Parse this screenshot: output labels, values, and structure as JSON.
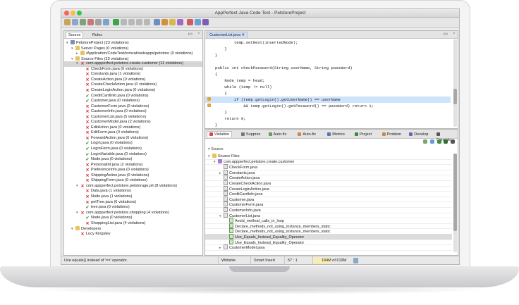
{
  "window": {
    "title": "AppPerfect Java Code Test - PetstoreProject"
  },
  "left_panel": {
    "tabs": [
      "Source",
      "Rules"
    ],
    "tree": [
      {
        "depth": 0,
        "twisty": "▾",
        "icon": "project",
        "label": "PetstoreProject (23 violations)"
      },
      {
        "depth": 1,
        "twisty": "▾",
        "icon": "folder",
        "label": "Server Pages (0 violations)"
      },
      {
        "depth": 2,
        "twisty": "▸",
        "icon": "folder",
        "label": "/Application/CodeTest/tomcat/webapps/petstore (0 violations)"
      },
      {
        "depth": 1,
        "twisty": "▾",
        "icon": "folder",
        "label": "Source Files (23 violations)"
      },
      {
        "depth": 2,
        "twisty": "▾",
        "icon": "x",
        "label": "com.appperfect.petstore.create.customer (11 violations)",
        "selected": true
      },
      {
        "depth": 3,
        "twisty": "",
        "icon": "x",
        "label": "CheckForm.java (0 violations)"
      },
      {
        "depth": 3,
        "twisty": "",
        "icon": "x",
        "label": "Constants.java (1 violations)"
      },
      {
        "depth": 3,
        "twisty": "",
        "icon": "x",
        "label": "CreateAction.java (0 violations)"
      },
      {
        "depth": 3,
        "twisty": "",
        "icon": "x",
        "label": "CreateCheckAction.java (0 violations)"
      },
      {
        "depth": 3,
        "twisty": "",
        "icon": "x",
        "label": "CreateLoginAction.java (0 violations)"
      },
      {
        "depth": 3,
        "twisty": "",
        "icon": "ok",
        "label": "CreditCardInfo.java (0 violations)"
      },
      {
        "depth": 3,
        "twisty": "",
        "icon": "ok",
        "label": "Customer.java (0 violations)"
      },
      {
        "depth": 3,
        "twisty": "",
        "icon": "x",
        "label": "CustomerForm.java (0 violations)"
      },
      {
        "depth": 3,
        "twisty": "",
        "icon": "x",
        "label": "CustomerInfo.java (0 violations)"
      },
      {
        "depth": 3,
        "twisty": "",
        "icon": "x",
        "label": "CustomerList.java (5 violations)"
      },
      {
        "depth": 3,
        "twisty": "",
        "icon": "x",
        "label": "CustomerModel.java (2 violations)"
      },
      {
        "depth": 3,
        "twisty": "",
        "icon": "x",
        "label": "EditAction.java (0 violations)"
      },
      {
        "depth": 3,
        "twisty": "",
        "icon": "x",
        "label": "EditForm.java (0 violations)"
      },
      {
        "depth": 3,
        "twisty": "",
        "icon": "x",
        "label": "ForwardAction.java (0 violations)"
      },
      {
        "depth": 3,
        "twisty": "",
        "icon": "ok",
        "label": "Login.java (0 violations)"
      },
      {
        "depth": 3,
        "twisty": "",
        "icon": "ok",
        "label": "LoginForm.java (0 violations)"
      },
      {
        "depth": 3,
        "twisty": "",
        "icon": "ok",
        "label": "LoginVariable.java (0 violations)"
      },
      {
        "depth": 3,
        "twisty": "",
        "icon": "ok",
        "label": "Node.java (0 violations)"
      },
      {
        "depth": 3,
        "twisty": "",
        "icon": "x",
        "label": "PersonalInf.java (2 violations)"
      },
      {
        "depth": 3,
        "twisty": "",
        "icon": "x",
        "label": "PreferenceInfo.java (0 violations)"
      },
      {
        "depth": 3,
        "twisty": "",
        "icon": "x",
        "label": "ShippingAction.java (0 violations)"
      },
      {
        "depth": 3,
        "twisty": "",
        "icon": "x",
        "label": "ShippingForm.java (0 violations)"
      },
      {
        "depth": 2,
        "twisty": "▾",
        "icon": "x",
        "label": "com.appperfect.petstore.petstorage.pit (8 violations)"
      },
      {
        "depth": 3,
        "twisty": "",
        "icon": "x",
        "label": "Data.java (1 violations)"
      },
      {
        "depth": 3,
        "twisty": "",
        "icon": "x",
        "label": "Node.java (1 violations)"
      },
      {
        "depth": 3,
        "twisty": "",
        "icon": "x",
        "label": "petTree.java (6 violations)"
      },
      {
        "depth": 3,
        "twisty": "",
        "icon": "ok",
        "label": "tree.java (0 violations)"
      },
      {
        "depth": 2,
        "twisty": "▾",
        "icon": "x",
        "label": "com.appperfect.petstore.shopping (4 violations)"
      },
      {
        "depth": 3,
        "twisty": "",
        "icon": "ok",
        "label": "Node.java (0 violations)"
      },
      {
        "depth": 3,
        "twisty": "",
        "icon": "x",
        "label": "ShoppingList.java (4 violations)"
      },
      {
        "depth": 1,
        "twisty": "▾",
        "icon": "folder",
        "label": "Developers"
      },
      {
        "depth": 2,
        "twisty": "",
        "icon": "x",
        "label": "Lucy Kingsley"
      }
    ]
  },
  "editor": {
    "tab": "CustomerList.java",
    "lines": [
      {
        "text": "        temp.setNext(insertedNode);",
        "hl": false
      },
      {
        "text": "    }",
        "hl": false
      },
      {
        "text": "}",
        "hl": false
      },
      {
        "text": "",
        "hl": false
      },
      {
        "text": "public int checkPassword(String userName, String passWord)",
        "hl": false
      },
      {
        "text": "{",
        "hl": false
      },
      {
        "text": "    Node temp = head;",
        "hl": false
      },
      {
        "text": "    while (temp != null)",
        "hl": false
      },
      {
        "text": "    {",
        "hl": false
      },
      {
        "text": "        if (temp.getLogin().getUserName() == userName",
        "hl": true
      },
      {
        "text": "            && temp.getLogin().getPassword() == passWord) return 1;",
        "hl": false
      },
      {
        "text": "    }",
        "hl": false
      },
      {
        "text": "    return 0;",
        "hl": false
      },
      {
        "text": "}",
        "hl": false
      }
    ]
  },
  "bottom_panel": {
    "tabs": [
      "Violation",
      "Suppres",
      "Auto-fix",
      "Auto-fix",
      "Metrics",
      "Project",
      "Problem",
      "Develop",
      "Console"
    ],
    "header": "Source",
    "rows": [
      {
        "depth": 0,
        "twisty": "▾",
        "icon": "folder",
        "label": "Source Files"
      },
      {
        "depth": 1,
        "twisty": "▾",
        "icon": "pkg",
        "label": "com.appperfect.petstore.create.customer"
      },
      {
        "depth": 2,
        "twisty": "",
        "icon": "file",
        "label": "CheckForm.java"
      },
      {
        "depth": 2,
        "twisty": "▸",
        "icon": "file",
        "label": "Constants.java"
      },
      {
        "depth": 2,
        "twisty": "",
        "icon": "file",
        "label": "CreateAction.java"
      },
      {
        "depth": 2,
        "twisty": "",
        "icon": "file",
        "label": "CreateCheckAction.java"
      },
      {
        "depth": 2,
        "twisty": "",
        "icon": "file",
        "label": "CreateLoginAction.java"
      },
      {
        "depth": 2,
        "twisty": "",
        "icon": "file",
        "label": "CreditCardInfo.java"
      },
      {
        "depth": 2,
        "twisty": "",
        "icon": "file",
        "label": "Customer.java"
      },
      {
        "depth": 2,
        "twisty": "",
        "icon": "file",
        "label": "CustomerForm.java"
      },
      {
        "depth": 2,
        "twisty": "",
        "icon": "file",
        "label": "CustomerInfo.java"
      },
      {
        "depth": 2,
        "twisty": "▾",
        "icon": "file",
        "label": "CustomerList.java"
      },
      {
        "depth": 3,
        "twisty": "",
        "icon": "rule",
        "label": "Avoid_method_calls_in_loop"
      },
      {
        "depth": 3,
        "twisty": "",
        "icon": "rule",
        "label": "Declare_methods_not_using_instance_members_static"
      },
      {
        "depth": 3,
        "twisty": "",
        "icon": "rule",
        "label": "Declare_methods_not_using_instance_members_static"
      },
      {
        "depth": 3,
        "twisty": "",
        "icon": "rule",
        "label": "Use_Equals_Instead_Equality_Operator",
        "selected": true
      },
      {
        "depth": 3,
        "twisty": "",
        "icon": "rule",
        "label": "Use_Equals_Instead_Equality_Operator"
      },
      {
        "depth": 2,
        "twisty": "▸",
        "icon": "file",
        "label": "CustomerModel.java"
      }
    ]
  },
  "status": {
    "message": "Use equals() instead of '==' operator.",
    "mode": "Writable",
    "insert": "Smart Insert",
    "position": "57 : 1",
    "memory": "184M of 619M",
    "memory_used_fraction": 0.297
  },
  "colors": {
    "error": "#dd2222",
    "ok": "#2a9a2a",
    "highlight": "#cfe3fb",
    "memory": "#f7eeb0"
  }
}
